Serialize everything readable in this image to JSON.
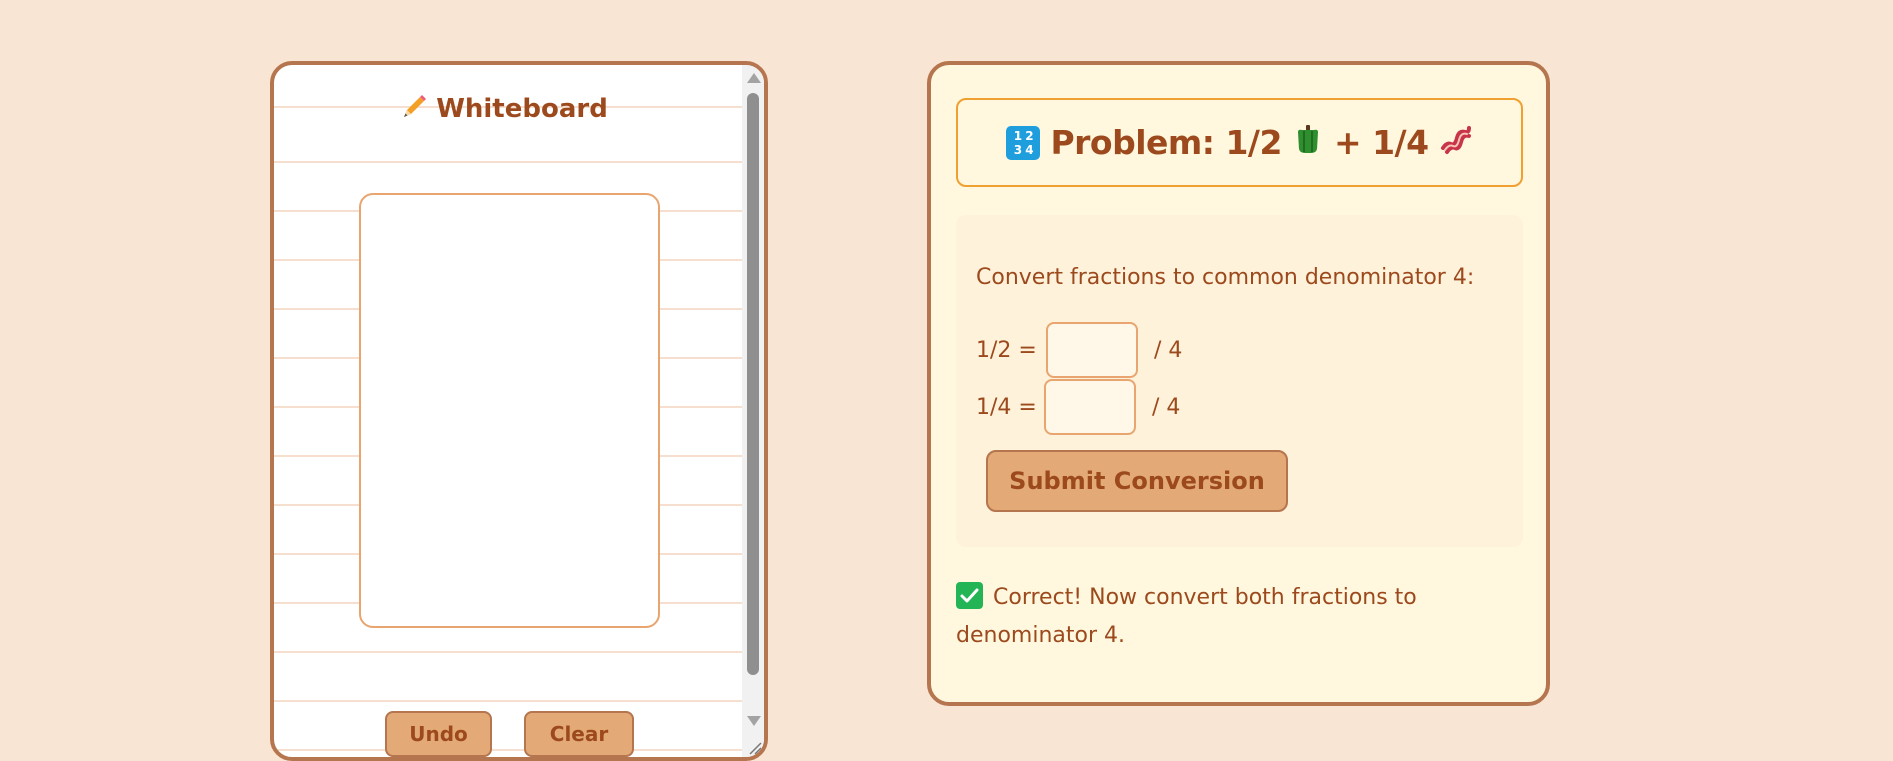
{
  "whiteboard": {
    "title": "Whiteboard",
    "undo_label": "Undo",
    "clear_label": "Clear"
  },
  "problem": {
    "prefix": "Problem: 1/2",
    "middle": "+ 1/4",
    "icons": [
      "input-numbers-icon",
      "green-pepper-icon",
      "bacon-icon"
    ]
  },
  "conversion": {
    "instruction": "Convert fractions to common denominator 4:",
    "rows": [
      {
        "label": "1/2 =",
        "value": "",
        "suffix": "/ 4"
      },
      {
        "label": "1/4 =",
        "value": "",
        "suffix": "/ 4"
      }
    ],
    "submit_label": "Submit Conversion"
  },
  "feedback": {
    "text": "Correct! Now convert both fractions to denominator 4."
  },
  "colors": {
    "background": "#f9e5d3",
    "accent": "#9c4a1d",
    "button": "#e3a976",
    "border": "#b5754e",
    "success": "#22b455"
  }
}
